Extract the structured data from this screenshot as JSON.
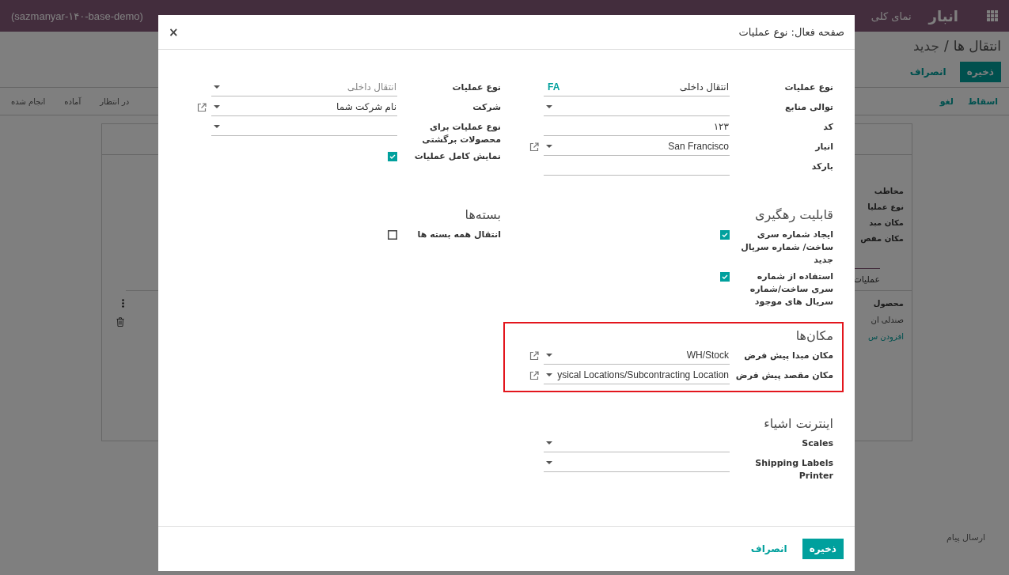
{
  "navbar": {
    "brand": "انبار",
    "menu": [
      {
        "label": "نمای کلی"
      }
    ],
    "database": "(sazmanyar-۱۴۰-base-demo)"
  },
  "breadcrumb": {
    "parent": "انتقال ها",
    "separator": "/",
    "current": "جدید"
  },
  "page_buttons": [
    {
      "label": "ذخیره",
      "kind": "primary"
    },
    {
      "label": "انصراف",
      "kind": "link"
    }
  ],
  "header_buttons": [
    {
      "label": "اسقاط"
    },
    {
      "label": "لغو"
    }
  ],
  "status_steps": [
    {
      "label": "در انتظار"
    },
    {
      "label": "آماده"
    },
    {
      "label": "انجام شده"
    }
  ],
  "sheet": {
    "fields": [
      "مخاطب",
      "نوع عملیا",
      "مکان مبد",
      "مکان مقص"
    ],
    "tab": "عملیات",
    "column": "محصول",
    "cell": "صندلی ان",
    "add_line": "افزودن س"
  },
  "chatter": {
    "send_message": "ارسال پیام"
  },
  "dialog": {
    "title": "صفحه فعال: نوع عملیات",
    "close": "×",
    "sections": [
      {
        "groups": [
          {
            "fields": [
              {
                "label": "نوع عملیات",
                "kind": "text",
                "value": "انتقال داخلی",
                "badge": "FA"
              },
              {
                "label": "توالی منابع",
                "kind": "select"
              },
              {
                "label": "کد",
                "kind": "text",
                "value": "۱۲۳"
              },
              {
                "label": "انبار",
                "kind": "select",
                "value": "San Francisco",
                "external_link": true
              },
              {
                "label": "بارکد",
                "kind": "text"
              }
            ]
          },
          {
            "fields": [
              {
                "label": "نوع عملیات",
                "kind": "select",
                "placeholder": "انتقال داخلی"
              },
              {
                "label": "شرکت",
                "kind": "select",
                "value": "نام شرکت شما",
                "external_link": true
              },
              {
                "label": "نوع عملیات برای محصولات برگشتی",
                "kind": "select"
              },
              {
                "label": "نمایش کامل عملیات",
                "kind": "checkbox",
                "checked": true
              }
            ]
          }
        ]
      },
      {
        "groups": [
          {
            "title": "قابلیت رهگیری",
            "fields": [
              {
                "label": "ایجاد شماره سری ساخت/ شماره سریال جدید",
                "kind": "checkbox",
                "checked": true
              },
              {
                "label": "استفاده از شماره سری ساخت/شماره سریال های موجود",
                "kind": "checkbox",
                "checked": true
              }
            ]
          },
          {
            "title": "بسته‌ها",
            "fields": [
              {
                "label": "انتقال همه بسته ها",
                "kind": "checkbox",
                "checked": false
              }
            ]
          }
        ]
      },
      {
        "groups": [
          {
            "title": "مکان‌ها",
            "highlighted": true,
            "fields": [
              {
                "label": "مکان مبدا پیش فرض",
                "kind": "select",
                "value": "WH/Stock",
                "external_link": true
              },
              {
                "label": "مکان مقصد پیش فرض",
                "kind": "select",
                "value": "ysical Locations/Subcontracting Location",
                "external_link": true
              }
            ]
          }
        ]
      },
      {
        "groups": [
          {
            "title": "اینترنت اشیاء",
            "fields": [
              {
                "label": "Scales",
                "kind": "select"
              },
              {
                "label": "Shipping Labels Printer",
                "kind": "select"
              }
            ]
          }
        ]
      }
    ],
    "buttons": [
      {
        "label": "ذخیره",
        "kind": "primary"
      },
      {
        "label": "انصراف",
        "kind": "link"
      }
    ]
  }
}
